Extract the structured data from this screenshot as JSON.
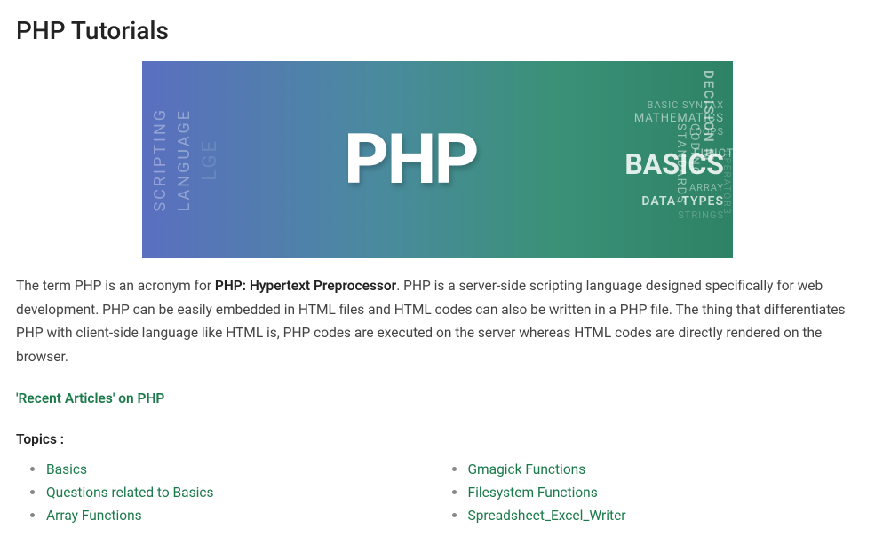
{
  "title": "PHP Tutorials",
  "banner": {
    "main": "PHP",
    "left": {
      "scripting": "SCRIPTING",
      "language": "LANGUAGE",
      "faint": "LGE"
    },
    "right": {
      "basic_syntax": "BASIC SYNTAX",
      "mathematics": "MATHEMATICS",
      "loops": "LOOPS",
      "functions": "FUNCTIONS",
      "basics": "BASICS",
      "array": "ARRAY",
      "data_types": "DATA-TYPES",
      "strings": "STRINGS",
      "decision": "DECISION M",
      "coding_standards": "CODING STANDARDS",
      "operators": "OPERATORS"
    }
  },
  "intro": {
    "pre": "The term PHP is an acronym for ",
    "bold": "PHP: Hypertext Preprocessor",
    "post": ". PHP is a server-side scripting language designed specifically for web development. PHP can be easily embedded in HTML files and HTML codes can also be written in a PHP file. The thing that differentiates PHP with client-side language like HTML is, PHP codes are executed on the server whereas HTML codes are directly rendered on the browser."
  },
  "recent_link": "'Recent Articles' on PHP",
  "topics_heading": "Topics :",
  "topics": {
    "left": [
      "Basics",
      "Questions related to Basics",
      "Array Functions"
    ],
    "right": [
      "Gmagick Functions",
      "Filesystem Functions",
      "Spreadsheet_Excel_Writer"
    ]
  }
}
